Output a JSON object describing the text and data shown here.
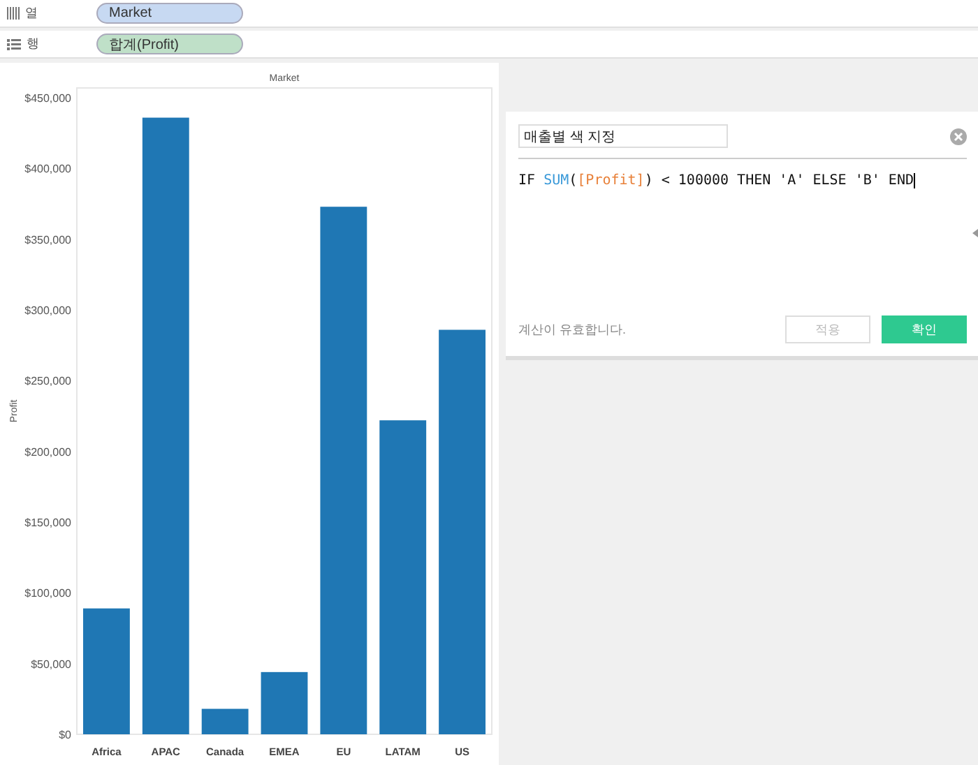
{
  "shelves": [
    {
      "kind": "columns",
      "label": "열",
      "pill": "Market",
      "color": "#c7d9f2"
    },
    {
      "kind": "rows",
      "label": "행",
      "pill": "합계(Profit)",
      "color": "#bfe0c8"
    }
  ],
  "chart": {
    "chart_data": {
      "type": "bar",
      "title": "Market",
      "ylabel": "Profit",
      "categories": [
        "Africa",
        "APAC",
        "Canada",
        "EMEA",
        "EU",
        "LATAM",
        "US"
      ],
      "values": [
        89000,
        436000,
        18000,
        44000,
        373000,
        222000,
        286000
      ],
      "ylim": [
        0,
        457000
      ],
      "yticks": [
        {
          "value": 0,
          "label": "$0"
        },
        {
          "value": 50000,
          "label": "$50,000"
        },
        {
          "value": 100000,
          "label": "$100,000"
        },
        {
          "value": 150000,
          "label": "$150,000"
        },
        {
          "value": 200000,
          "label": "$200,000"
        },
        {
          "value": 250000,
          "label": "$250,000"
        },
        {
          "value": 300000,
          "label": "$300,000"
        },
        {
          "value": 350000,
          "label": "$350,000"
        },
        {
          "value": 400000,
          "label": "$400,000"
        },
        {
          "value": 450000,
          "label": "$450,000"
        }
      ]
    }
  },
  "dialog": {
    "name": "매출별 색 지정",
    "formula": [
      {
        "kind": "plain",
        "text": "IF "
      },
      {
        "kind": "function",
        "text": "SUM"
      },
      {
        "kind": "plain",
        "text": "("
      },
      {
        "kind": "field",
        "text": "[Profit]"
      },
      {
        "kind": "plain",
        "text": ") < 100000 THEN 'A' ELSE 'B' END"
      }
    ],
    "status": "계산이 유효합니다.",
    "buttons": [
      {
        "label": "적용",
        "disabled": true,
        "primary": false
      },
      {
        "label": "확인",
        "disabled": false,
        "primary": true
      }
    ]
  }
}
